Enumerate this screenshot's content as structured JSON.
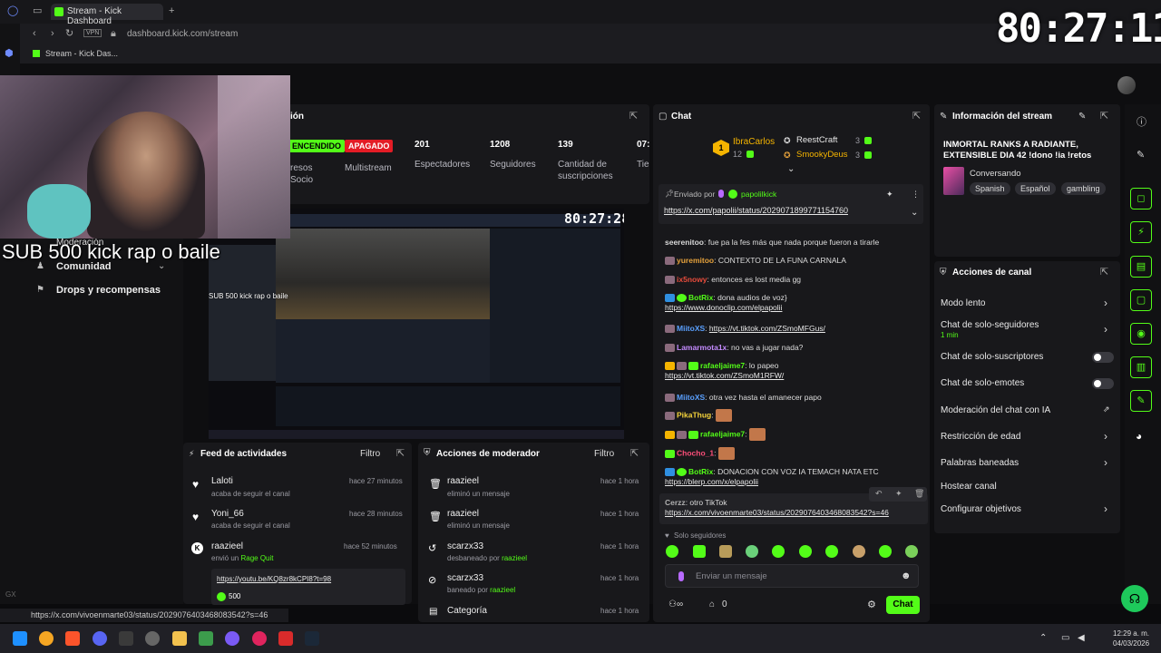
{
  "browser": {
    "tab_title": "Stream - Kick Dashboard",
    "tab_new": "+",
    "vpn_label": "VPN",
    "url": "dashboard.kick.com/stream",
    "bookmark": "Stream - Kick Das...",
    "status_url": "https://x.com/vivoenmarte03/status/2029076403468083542?s=46"
  },
  "overlay": {
    "clock": "80:27:11",
    "sub_text": "SUB 500 kick  rap o  baile",
    "preview_clock": "80:27:28",
    "preview_sub_text": "SUB 500 kick  rap o  baile"
  },
  "left_nav": {
    "items": [
      "Moderación",
      "Comunidad",
      "Drops y recompensas"
    ]
  },
  "section_title": "ión",
  "stats": {
    "status_on": "ENCENDIDO",
    "status_off": "APAGADO",
    "col1_label_a": "resos",
    "col1_label_b": "Socio",
    "multistream": "Multistream",
    "viewers": "201",
    "viewers_label": "Espectadores",
    "followers": "1208",
    "followers_label": "Seguidores",
    "subs": "139",
    "subs_label_a": "Cantidad de",
    "subs_label_b": "suscripciones",
    "time": "07:",
    "time_label": "Tie"
  },
  "activity": {
    "title": "Feed de actividades",
    "filter": "Filtro",
    "items": [
      {
        "name": "Laloti",
        "text": "acaba de seguir el canal",
        "time": "hace 27 minutos"
      },
      {
        "name": "Yoni_66",
        "text": "acaba de seguir el canal",
        "time": "hace 28 minutos"
      },
      {
        "name": "raazieel",
        "text_prefix": "envió un",
        "text_highlight": "Rage Quit",
        "time": "hace 52 minutos",
        "link": "https://youtu.be/KQ8zr8kCPI8?t=98",
        "amount": "500"
      }
    ]
  },
  "modactions": {
    "title": "Acciones de moderador",
    "filter": "Filtro",
    "items": [
      {
        "name": "raazieel",
        "text": "eliminó un mensaje",
        "time": "hace 1 hora"
      },
      {
        "name": "raazieel",
        "text": "eliminó un mensaje",
        "time": "hace 1 hora"
      },
      {
        "name": "scarzx33",
        "text_prefix": "desbaneado por",
        "text_highlight": "raazieel",
        "time": "hace 1 hora"
      },
      {
        "name": "scarzx33",
        "text_prefix": "baneado por",
        "text_highlight": "raazieel",
        "time": "hace 1 hora"
      },
      {
        "name": "Categoría",
        "text": "",
        "time": "hace 1 hora"
      }
    ]
  },
  "chat": {
    "title": "Chat",
    "top_rank": "1",
    "leader1_name": "IbraCarlos",
    "leader1_count": "12",
    "leader2_name": "ReestCraft",
    "leader2_count": "3",
    "leader3_name": "SmookyDeus",
    "leader3_count": "3",
    "pinned_label": "Enviado por",
    "pinned_user": "papolilkick",
    "pinned_link": "https://x.com/papolii/status/2029071899771154760",
    "messages": [
      {
        "user": "seerenitoo",
        "color": "#d8d8d8",
        "text": "fue pa la fes más que nada porque fueron a tirarle"
      },
      {
        "user": "yuremitoo",
        "color": "#e6a23c",
        "text": "CONTEXTO DE LA FUNA CARNALA"
      },
      {
        "user": "ix5nowy",
        "color": "#e74c3c",
        "text": "entonces es lost media gg"
      },
      {
        "user": "BotRix",
        "color": "#53fc18",
        "text": "dona audios de voz}",
        "link": "https://www.donoclip.com/elpapolii"
      },
      {
        "user": "MiitoXS",
        "color": "#5aa0ff",
        "link": "https://vt.tiktok.com/ZSmoMFGus/"
      },
      {
        "user": "Lamarmota1x",
        "color": "#c48bff",
        "text": "no vas a jugar nada?"
      },
      {
        "user": "rafaeljaime7",
        "color": "#53fc18",
        "text": "lo papeo",
        "link": "https://vt.tiktok.com/ZSmoM1RFW/"
      },
      {
        "user": "MiitoXS",
        "color": "#5aa0ff",
        "text": "otra vez hasta el amanecer papo"
      },
      {
        "user": "PikaThug",
        "color": "#f5d33b",
        "text": ""
      },
      {
        "user": "rafaeljaime7",
        "color": "#53fc18",
        "text": ""
      },
      {
        "user": "Chocho_1",
        "color": "#ff4f7a",
        "text": ""
      },
      {
        "user": "BotRix",
        "color": "#53fc18",
        "text": "DONACION CON VOZ IA TEMACH NATA ETC",
        "link": "https://blerp.com/x/elpapolii"
      },
      {
        "user": "Cerzz",
        "color": "#b0b0b0",
        "text": "otro TikTok",
        "link": "https://x.com/vivoenmarte03/status/2029076403468083542?s=46"
      }
    ],
    "followers_only": "Solo seguidores",
    "input_placeholder": "Enviar un mensaje",
    "viewer_count": "0",
    "send_label": "Chat"
  },
  "stream_info": {
    "title": "Información del stream",
    "stream_title": "INMORTAL RANKS A RADIANTE, EXTENSIBLE DIA 42 !dono !ia !retos",
    "category": "Conversando",
    "tags": [
      "Spanish",
      "Español",
      "gambling"
    ]
  },
  "channel_actions": {
    "title": "Acciones de canal",
    "items": [
      {
        "label": "Modo lento",
        "type": "chevron"
      },
      {
        "label": "Chat de solo-seguidores",
        "sub": "1 min",
        "type": "chevron"
      },
      {
        "label": "Chat de solo-suscriptores",
        "type": "toggle"
      },
      {
        "label": "Chat de solo-emotes",
        "type": "toggle"
      },
      {
        "label": "Moderación del chat con IA",
        "type": "external"
      },
      {
        "label": "Restricción de edad",
        "type": "chevron"
      },
      {
        "label": "Palabras baneadas",
        "type": "chevron"
      },
      {
        "label": "Hostear canal",
        "type": "none"
      },
      {
        "label": "Configurar objetivos",
        "type": "chevron"
      }
    ]
  },
  "taskbar": {
    "time": "12:29 a. m.",
    "date": "04/03/2026"
  },
  "colors": {
    "accent": "#53fc18",
    "danger": "#e31c25",
    "panel": "#18181b"
  }
}
